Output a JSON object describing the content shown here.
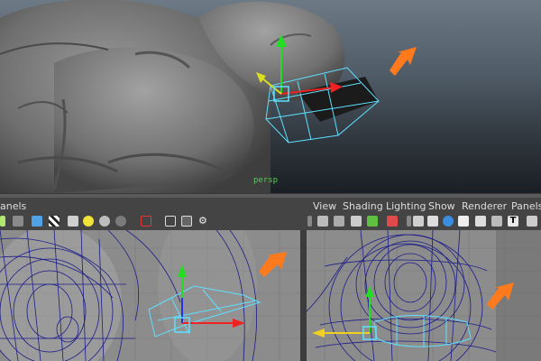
{
  "top_viewport": {
    "camera_label": "persp"
  },
  "left_panel_header": {
    "panels_label": "anels"
  },
  "right_panel_menu": {
    "items": [
      "View",
      "Shading",
      "Lighting",
      "Show",
      "Renderer",
      "Panels"
    ]
  },
  "icons": {
    "toolbar_left": [
      "select-camera-icon",
      "cube-icon",
      "checker-icon",
      "light-icon",
      "sphere-icon",
      "grey-sphere-icon",
      "xray-icon",
      "wireframe-icon",
      "isolate-icon",
      "share-icon"
    ],
    "toolbar_right": [
      "camera-icon",
      "camera-attr-icon",
      "film-icon",
      "select-icon",
      "close-icon",
      "grid-icon",
      "film-gate-icon",
      "sphere-icon",
      "shaded-icon",
      "xray-icon",
      "texture-icon",
      "more-icon"
    ]
  },
  "colors": {
    "wireframe": "#1c1c8a",
    "selection": "#5fe0ff",
    "arrow": "#ff7a1c",
    "manip_y": "#22dd22",
    "manip_x": "#ee2222",
    "manip_z": "#2233ee"
  }
}
